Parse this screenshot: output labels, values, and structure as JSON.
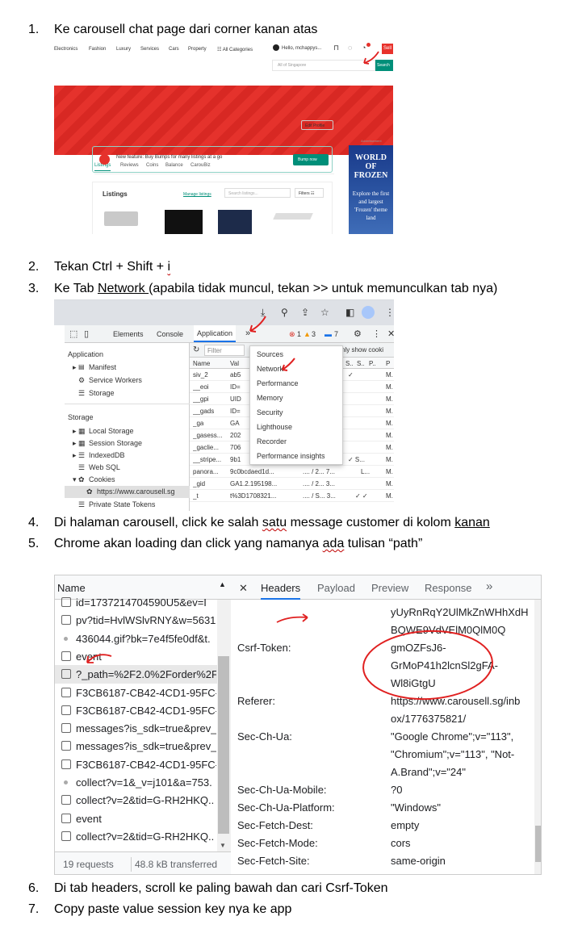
{
  "steps": [
    {
      "num": "1.",
      "text": "Ke carousell chat page dari corner kanan atas"
    },
    {
      "num": "2.",
      "text_a": "Tekan Ctrl + Shift + ",
      "text_b": "i"
    },
    {
      "num": "3.",
      "text_a": "Ke Tab ",
      "link": "Network ",
      "text_b": " (apabila tidak muncul, tekan >> untuk memunculkan tab nya)"
    },
    {
      "num": "4.",
      "text_a": "Di halaman carousell, click ke salah ",
      "squig": "satu",
      "text_b": " message customer di kolom ",
      "link": "kanan"
    },
    {
      "num": "5.",
      "text_a": "Chrome akan loading dan click yang namanya ",
      "squig": "ada",
      "text_b": " tulisan “path”"
    },
    {
      "num": "6.",
      "text": "Di tab headers, scroll ke paling bawah dan cari Csrf-Token"
    },
    {
      "num": "7.",
      "text": "Copy paste value session key nya ke app"
    }
  ],
  "carousell": {
    "nav": [
      "Electronics",
      "Fashion",
      "Luxury",
      "Services",
      "Cars",
      "Property",
      "☷ All Categories"
    ],
    "user": "Hello, mchappys...",
    "sell": "Sell",
    "location_placeholder": "All of Singapore",
    "search": "Search",
    "tabs": [
      "Listings",
      "Reviews",
      "Coins",
      "Balance",
      "CarouBiz"
    ],
    "edit_profile": "Edit Profile",
    "bump_text": "New feature: Buy Bumps for many listings at a go",
    "bump_button": "Bump now",
    "listings_title": "Listings",
    "manage_listings": "Manage listings",
    "search_listings": "Search listings...",
    "filters": "Filters ☷",
    "ad_label": "Advertisement",
    "ad_title": "WORLD OF FROZEN",
    "ad_text": "Explore the first and largest 'Frozen' theme land"
  },
  "devtools_app": {
    "tabs": [
      "Elements",
      "Console",
      "Application",
      "»"
    ],
    "errors": "1",
    "warnings": "3",
    "messages": "7",
    "filter_placeholder": "Filter",
    "only_cookies": "nly show cooki",
    "left_section_app": "Application",
    "left_items_app": [
      "Manifest",
      "Service Workers",
      "Storage"
    ],
    "left_section_storage": "Storage",
    "left_items_storage": [
      "Local Storage",
      "Session Storage",
      "IndexedDB",
      "Web SQL",
      "Cookies",
      "https://www.carousell.sg",
      "Private State Tokens"
    ],
    "columns": [
      "Name",
      "Val",
      "S..",
      "S..",
      "P..",
      "P"
    ],
    "rows": [
      [
        "siv_2",
        "ab5",
        "✓"
      ],
      [
        "__eoi",
        "ID="
      ],
      [
        "__gpi",
        "UID"
      ],
      [
        "__gads",
        "ID="
      ],
      [
        "_ga",
        "GA"
      ],
      [
        "_gasess...",
        "202"
      ],
      [
        "_gaclie...",
        "706"
      ],
      [
        "__stripe...",
        "9b1",
        "✓ S..."
      ],
      [
        "panora...",
        "9c0bcdaed1d...",
        "L..."
      ],
      [
        "_gid",
        "GA1.2.195198..."
      ],
      [
        "_t",
        "t%3D1708321...",
        "✓ ✓"
      ]
    ],
    "menu": [
      "Sources",
      "Network",
      "Performance",
      "Memory",
      "Security",
      "Lighthouse",
      "Recorder",
      "Performance insights"
    ]
  },
  "network": {
    "name_header": "Name",
    "requests": [
      {
        "type": "cb",
        "name": "id=1737214704590U5&ev=I"
      },
      {
        "type": "cb",
        "name": "pv?tid=HvlWSlvRNY&w=5631"
      },
      {
        "type": "dot",
        "name": "436044.gif?bk=7e4f5fe0df&t."
      },
      {
        "type": "cb",
        "name": "event"
      },
      {
        "type": "cb",
        "name": "?_path=%2F2.0%2Forder%2Fl"
      },
      {
        "type": "cb",
        "name": "F3CB6187-CB42-4CD1-95FC-."
      },
      {
        "type": "cb",
        "name": "F3CB6187-CB42-4CD1-95FC-."
      },
      {
        "type": "cb",
        "name": "messages?is_sdk=true&prev_"
      },
      {
        "type": "cb",
        "name": "messages?is_sdk=true&prev_"
      },
      {
        "type": "cb",
        "name": "F3CB6187-CB42-4CD1-95FC-."
      },
      {
        "type": "dot",
        "name": "collect?v=1&_v=j101&a=753."
      },
      {
        "type": "cb",
        "name": "collect?v=2&tid=G-RH2HKQ.."
      },
      {
        "type": "cb",
        "name": "event"
      },
      {
        "type": "cb",
        "name": "collect?v=2&tid=G-RH2HKQ.."
      }
    ],
    "requests_count": "19 requests",
    "transferred": "48.8 kB transferred",
    "tabs": [
      "✕",
      "Headers",
      "Payload",
      "Preview",
      "Response",
      "»"
    ],
    "headers": [
      {
        "key": "",
        "value": "yUyRnRqY2UlMkZnWHhXdH"
      },
      {
        "key": "",
        "value": "BQWE9VdVElM0QlM0Q"
      },
      {
        "key": "Csrf-Token:",
        "value": "gmOZFsJ6-"
      },
      {
        "key": "",
        "value": "GrMoP41h2lcnSl2gFA-"
      },
      {
        "key": "",
        "value": "Wl8iGtgU"
      },
      {
        "key": "Referer:",
        "value": "https://www.carousell.sg/inb"
      },
      {
        "key": "",
        "value": "ox/1776375821/"
      },
      {
        "key": "Sec-Ch-Ua:",
        "value": "\"Google Chrome\";v=\"113\","
      },
      {
        "key": "",
        "value": "\"Chromium\";v=\"113\", \"Not-"
      },
      {
        "key": "",
        "value": "A.Brand\";v=\"24\""
      },
      {
        "key": "Sec-Ch-Ua-Mobile:",
        "value": "?0"
      },
      {
        "key": "Sec-Ch-Ua-Platform:",
        "value": "\"Windows\""
      },
      {
        "key": "Sec-Fetch-Dest:",
        "value": "empty"
      },
      {
        "key": "Sec-Fetch-Mode:",
        "value": "cors"
      },
      {
        "key": "Sec-Fetch-Site:",
        "value": "same-origin"
      }
    ]
  },
  "colors": {
    "annotation_red": "#e02020",
    "carousell_green": "#008f79",
    "carousell_red": "#e5322c",
    "devtools_blue": "#1a73e8"
  }
}
